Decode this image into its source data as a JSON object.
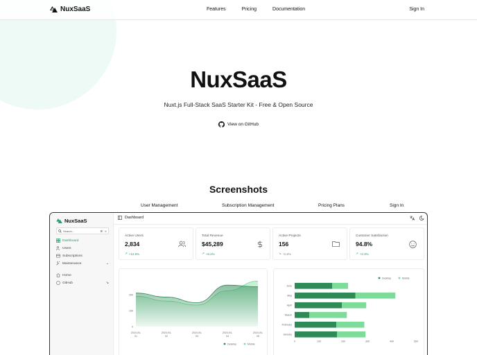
{
  "nav": {
    "brand": "NuxSaaS",
    "links": [
      "Features",
      "Pricing",
      "Documentation"
    ],
    "sign_in": "Sign In"
  },
  "hero": {
    "title": "NuxSaaS",
    "subtitle": "Nuxt.js Full-Stack SaaS Starter Kit - Free & Open Source",
    "github_label": "View on GitHub"
  },
  "screenshots": {
    "title": "Screenshots",
    "tabs": [
      "User Management",
      "Subscription Management",
      "Pricing Plans",
      "Sign In"
    ]
  },
  "app": {
    "brand": "NuxSaaS",
    "search_placeholder": "Search...",
    "search_shortcut": [
      "⌘",
      "K"
    ],
    "sidebar": [
      {
        "label": "Dashboard",
        "icon": "dashboard-icon",
        "active": true
      },
      {
        "label": "Users",
        "icon": "users-icon",
        "active": false
      },
      {
        "label": "Subscriptions",
        "icon": "subscriptions-icon",
        "active": false
      },
      {
        "label": "Maintenance",
        "icon": "wrench-icon",
        "active": false
      },
      {
        "label": "Home",
        "icon": "home-icon",
        "active": false
      },
      {
        "label": "GitHub",
        "icon": "github-icon",
        "active": false
      }
    ],
    "page_title": "Dashboard",
    "accent": "#22a06b"
  },
  "stats": [
    {
      "label": "Active Users",
      "value": "2,834",
      "change": "+12.5%",
      "trend": "up",
      "icon": "users-icon"
    },
    {
      "label": "Total Revenue",
      "value": "$45,289",
      "change": "+8.2%",
      "trend": "up",
      "icon": "dollar-icon"
    },
    {
      "label": "Active Projects",
      "value": "156",
      "change": "-3.1%",
      "trend": "down",
      "icon": "folder-icon"
    },
    {
      "label": "Customer Satisfaction",
      "value": "94.8%",
      "change": "+2.3%",
      "trend": "up",
      "icon": "smiley-icon"
    }
  ],
  "chart_data": [
    {
      "type": "area",
      "x": [
        "2024-04-01",
        "2024-04-02",
        "2024-04-03",
        "2024-04-04",
        "2024-04-05"
      ],
      "ylim": [
        0,
        300
      ],
      "yticks": [
        0,
        100,
        200
      ],
      "series": [
        {
          "name": "Desktop",
          "color": "#2e8b57",
          "values": [
            210,
            185,
            150,
            260,
            250
          ]
        },
        {
          "name": "Mobile",
          "color": "#7ddc9a",
          "values": [
            190,
            160,
            135,
            225,
            285
          ]
        }
      ],
      "legend": "bottom-right"
    },
    {
      "type": "bar",
      "orientation": "horizontal",
      "stacked": true,
      "categories": [
        "June",
        "May",
        "April",
        "March",
        "February",
        "January"
      ],
      "xlim": [
        0,
        500
      ],
      "xticks": [
        0,
        100,
        200,
        300,
        400,
        500
      ],
      "series": [
        {
          "name": "Desktop",
          "color": "#2e8b57",
          "values": [
            155,
            250,
            195,
            60,
            172,
            175
          ]
        },
        {
          "name": "Mobile",
          "color": "#7ddc9a",
          "values": [
            65,
            165,
            100,
            155,
            115,
            117
          ]
        }
      ],
      "legend": "top-right"
    }
  ]
}
